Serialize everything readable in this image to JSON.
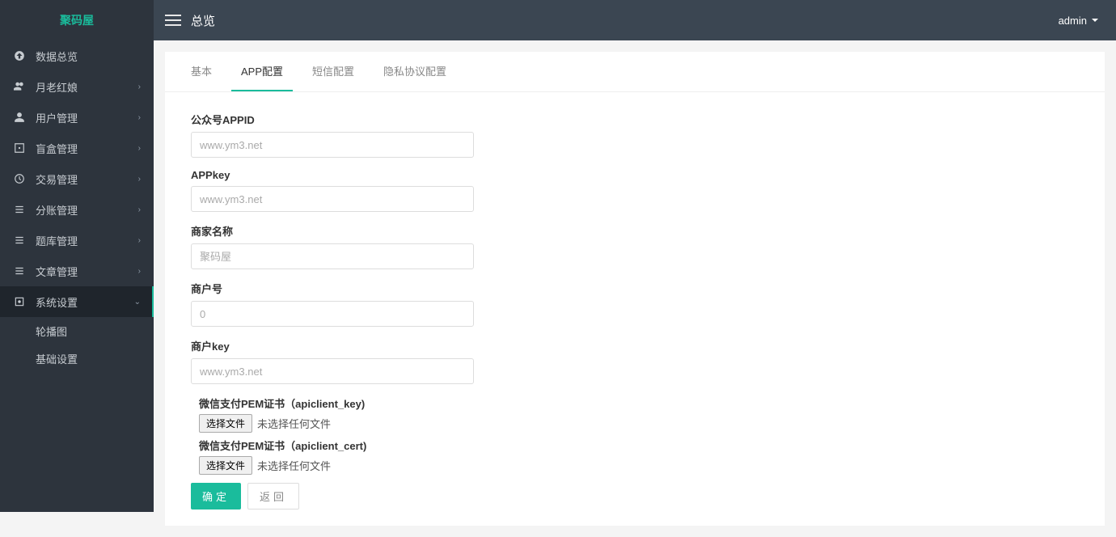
{
  "logo": "聚码屋",
  "sidebar": {
    "items": [
      {
        "label": "数据总览",
        "icon": "dashboard",
        "expandable": false
      },
      {
        "label": "月老红娘",
        "icon": "users",
        "expandable": true
      },
      {
        "label": "用户管理",
        "icon": "user",
        "expandable": true
      },
      {
        "label": "盲盒管理",
        "icon": "box",
        "expandable": true
      },
      {
        "label": "交易管理",
        "icon": "transaction",
        "expandable": true
      },
      {
        "label": "分账管理",
        "icon": "split",
        "expandable": true
      },
      {
        "label": "题库管理",
        "icon": "question",
        "expandable": true
      },
      {
        "label": "文章管理",
        "icon": "article",
        "expandable": true
      },
      {
        "label": "系统设置",
        "icon": "settings",
        "expandable": true,
        "active": true
      }
    ],
    "subitems": [
      {
        "label": "轮播图"
      },
      {
        "label": "基础设置"
      }
    ]
  },
  "header": {
    "title": "总览",
    "user": "admin"
  },
  "tabs": [
    {
      "label": "基本"
    },
    {
      "label": "APP配置",
      "active": true
    },
    {
      "label": "短信配置"
    },
    {
      "label": "隐私协议配置"
    }
  ],
  "form": {
    "fields": [
      {
        "label": "公众号APPID",
        "placeholder": "www.ym3.net",
        "value": ""
      },
      {
        "label": "APPkey",
        "placeholder": "www.ym3.net",
        "value": ""
      },
      {
        "label": "商家名称",
        "placeholder": "聚码屋",
        "value": ""
      },
      {
        "label": "商户号",
        "placeholder": "0",
        "value": ""
      },
      {
        "label": "商户key",
        "placeholder": "www.ym3.net",
        "value": ""
      }
    ],
    "file1": {
      "label": "微信支付PEM证书（apiclient_key)",
      "button": "选择文件",
      "status": "未选择任何文件"
    },
    "file2": {
      "label": "微信支付PEM证书（apiclient_cert)",
      "button": "选择文件",
      "status": "未选择任何文件"
    },
    "submit": "确定",
    "back": "返回"
  }
}
